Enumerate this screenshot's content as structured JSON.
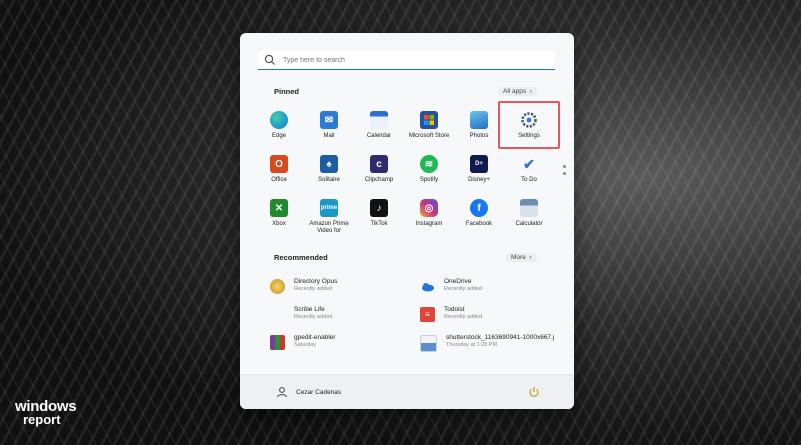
{
  "search": {
    "placeholder": "Type here to search"
  },
  "pinned": {
    "title": "Pinned",
    "all_apps_label": "All apps",
    "apps": [
      {
        "label": "Edge",
        "icon": "edge-icon",
        "color": "#1f8fd8"
      },
      {
        "label": "Mail",
        "icon": "mail-icon",
        "color": "#2c7ad6"
      },
      {
        "label": "Calendar",
        "icon": "calendar-icon",
        "color": "#2b6fd0"
      },
      {
        "label": "Microsoft Store",
        "icon": "store-icon",
        "color": "#2a4f9e"
      },
      {
        "label": "Photos",
        "icon": "photos-icon",
        "color": "#3aa0e0"
      },
      {
        "label": "Settings",
        "icon": "settings-icon",
        "color": "#4a5a6a"
      },
      {
        "label": "Office",
        "icon": "office-icon",
        "color": "#d94a1e"
      },
      {
        "label": "Solitaire",
        "icon": "solitaire-icon",
        "color": "#1b5ea6"
      },
      {
        "label": "Clipchamp",
        "icon": "clipchamp-icon",
        "color": "#2e2b6f"
      },
      {
        "label": "Spotify",
        "icon": "spotify-icon",
        "color": "#1db954"
      },
      {
        "label": "Disney+",
        "icon": "disney-icon",
        "color": "#0f1a4d"
      },
      {
        "label": "To Do",
        "icon": "todo-icon",
        "color": "#2f6fe0"
      },
      {
        "label": "Xbox",
        "icon": "xbox-icon",
        "color": "#1f8a2e"
      },
      {
        "label": "Amazon Prime Video for",
        "icon": "prime-video-icon",
        "color": "#1a98c8"
      },
      {
        "label": "TikTok",
        "icon": "tiktok-icon",
        "color": "#111111"
      },
      {
        "label": "Instagram",
        "icon": "instagram-icon",
        "color": "#c13584"
      },
      {
        "label": "Facebook",
        "icon": "facebook-icon",
        "color": "#1877f2"
      },
      {
        "label": "Calculator",
        "icon": "calculator-icon",
        "color": "#5b7c99"
      }
    ]
  },
  "recommended": {
    "title": "Recommended",
    "more_label": "More",
    "items": [
      {
        "name": "Directory Opus",
        "sub": "Recently added",
        "icon": "directory-opus-icon",
        "color": "#e8b730"
      },
      {
        "name": "OneDrive",
        "sub": "Recently added",
        "icon": "onedrive-icon",
        "color": "#1e7ad6"
      },
      {
        "name": "Scribe Life",
        "sub": "Recently added",
        "icon": "scribe-life-icon",
        "color": "#f7f8fa"
      },
      {
        "name": "Todoist",
        "sub": "Recently added",
        "icon": "todoist-icon",
        "color": "#e0443b"
      },
      {
        "name": "gpedit-enabler",
        "sub": "Saturday",
        "icon": "winrar-icon",
        "color": "#7a3d8f"
      },
      {
        "name": "shutterstock_1163690941-1000x667.j",
        "sub": "Thursday at 1:28 PM",
        "icon": "image-file-icon",
        "color": "#5a8fd0"
      }
    ]
  },
  "user": {
    "name": "Cezar Cadenas"
  },
  "brand": {
    "line1": "windows",
    "line2": "report"
  }
}
